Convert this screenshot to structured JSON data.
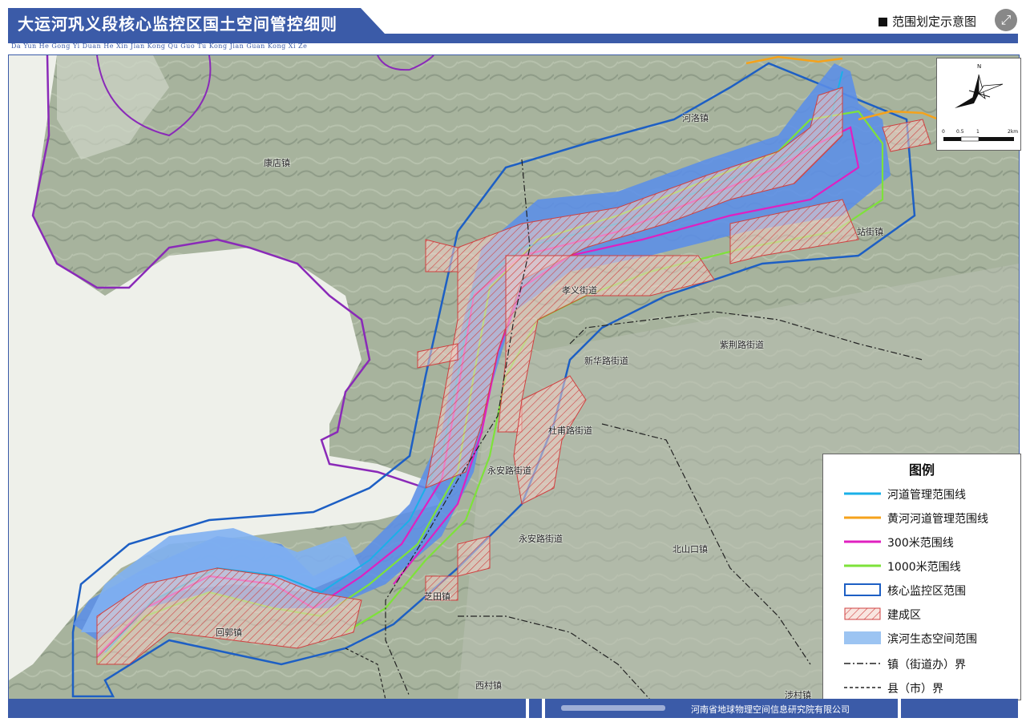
{
  "header": {
    "title": "大运河巩义段核心监控区国土空间管控细则",
    "subtitle": "Da Yun He Gong Yi Duan He Xin Jian Kong Qu Guo Tu Kong Jian Guan Kong  Xi Ze",
    "map_title": "范围划定示意图",
    "corner_icon": "expand-icon"
  },
  "compass": {
    "north_label": "N",
    "scale_labels": [
      "0",
      "0.5",
      "1",
      "2km"
    ]
  },
  "place_names": [
    {
      "name": "康店镇"
    },
    {
      "name": "河洛镇"
    },
    {
      "name": "站街镇"
    },
    {
      "name": "孝义街道"
    },
    {
      "name": "紫荆路街道"
    },
    {
      "name": "新华路街道"
    },
    {
      "name": "杜甫路街道"
    },
    {
      "name": "永安路街道"
    },
    {
      "name": "永安路街道"
    },
    {
      "name": "北山口镇"
    },
    {
      "name": "芝田镇"
    },
    {
      "name": "回郭镇"
    },
    {
      "name": "西村镇"
    },
    {
      "name": "涉村镇"
    }
  ],
  "legend": {
    "title": "图例",
    "items": [
      {
        "label": "河道管理范围线",
        "type": "line",
        "color": "#1ab0e8"
      },
      {
        "label": "黄河河道管理范围线",
        "type": "line",
        "color": "#f5a21b"
      },
      {
        "label": "300米范围线",
        "type": "line",
        "color": "#e020c0"
      },
      {
        "label": "1000米范围线",
        "type": "line",
        "color": "#7ee23a"
      },
      {
        "label": "核心监控区范围",
        "type": "box",
        "color": "#1d5fc4"
      },
      {
        "label": "建成区",
        "type": "hatch",
        "color": "#d04040"
      },
      {
        "label": "滨河生态空间范围",
        "type": "fill",
        "color": "#9cc4f2"
      },
      {
        "label": "镇（街道办）界",
        "type": "dashdot",
        "color": "#222222"
      },
      {
        "label": "县（市）界",
        "type": "dash",
        "color": "#222222"
      }
    ]
  },
  "footer": {
    "org": "河南省地球物理空间信息研究院有限公司"
  }
}
